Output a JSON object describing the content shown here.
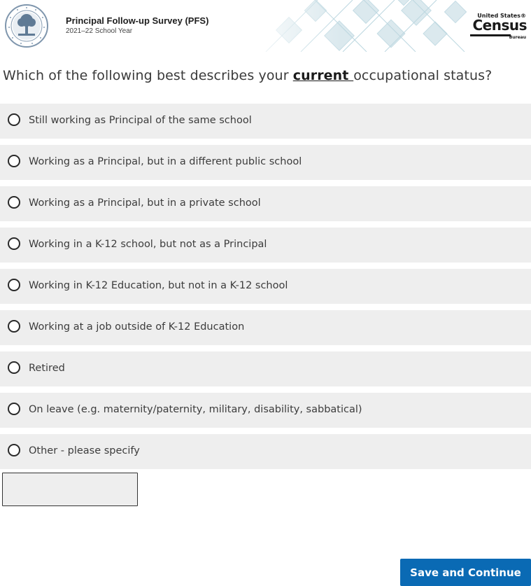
{
  "header": {
    "survey_title": "Principal Follow-up Survey (PFS)",
    "survey_year": "2021–22 School Year",
    "logo": {
      "united_states": "United States®",
      "census": "Census",
      "bureau": "Bureau"
    },
    "seal_icon": "department-of-education-seal-icon",
    "logo_icon": "census-bureau-logo-icon"
  },
  "question": {
    "prefix": "Which of the following best describes your ",
    "emphasis": "current ",
    "suffix": "occupational status?"
  },
  "options": [
    {
      "label": "Still working as Principal of the same school"
    },
    {
      "label": "Working as a Principal, but in a different public school"
    },
    {
      "label": "Working as a Principal, but in a private school"
    },
    {
      "label": "Working in a K-12 school, but not as a Principal"
    },
    {
      "label": "Working in K-12 Education, but not in a K-12 school"
    },
    {
      "label": "Working at a job outside of K-12 Education"
    },
    {
      "label": "Retired"
    },
    {
      "label": "On leave (e.g. maternity/paternity, military, disability, sabbatical)"
    },
    {
      "label": "Other - please specify"
    }
  ],
  "specify_input": {
    "value": "",
    "placeholder": ""
  },
  "footer": {
    "save_label": "Save and Continue"
  },
  "colors": {
    "primary_button": "#0a6ab4",
    "option_background": "#eeeeee",
    "header_pattern": "#cfe3ea"
  }
}
